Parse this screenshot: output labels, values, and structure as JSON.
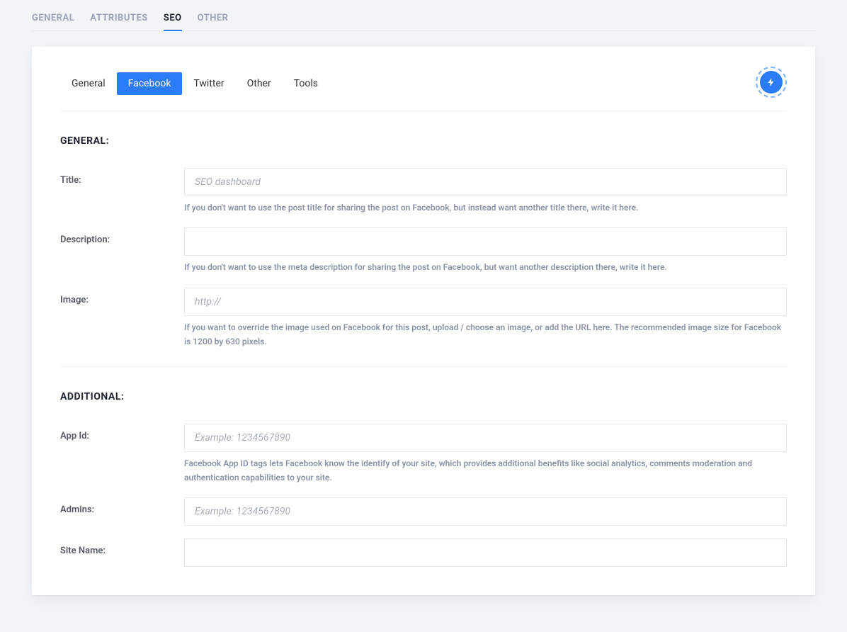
{
  "topTabs": {
    "general": "GENERAL",
    "attributes": "ATTRIBUTES",
    "seo": "SEO",
    "other": "OTHER"
  },
  "subTabs": {
    "general": "General",
    "facebook": "Facebook",
    "twitter": "Twitter",
    "other": "Other",
    "tools": "Tools"
  },
  "sections": {
    "general": {
      "heading": "GENERAL:",
      "title": {
        "label": "Title:",
        "placeholder": "SEO dashboard",
        "help": "If you don't want to use the post title for sharing the post on Facebook, but instead want another title there, write it here."
      },
      "description": {
        "label": "Description:",
        "help": "If you don't want to use the meta description for sharing the post on Facebook, but want another description there, write it here."
      },
      "image": {
        "label": "Image:",
        "placeholder": "http://",
        "help": "If you want to override the image used on Facebook for this post, upload / choose an image, or add the URL here. The recommended image size for Facebook is 1200 by 630 pixels."
      }
    },
    "additional": {
      "heading": "ADDITIONAL:",
      "appId": {
        "label": "App Id:",
        "placeholder": "Example: 1234567890",
        "help": "Facebook App ID tags lets Facebook know the identify of your site, which provides additional benefits like social analytics, comments moderation and authentication capabilities to your site."
      },
      "admins": {
        "label": "Admins:",
        "placeholder": "Example: 1234567890"
      },
      "siteName": {
        "label": "Site Name:"
      }
    }
  }
}
